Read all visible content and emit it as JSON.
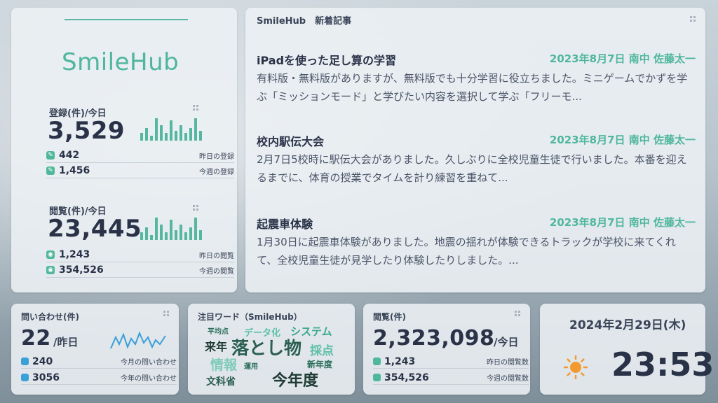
{
  "logo": "SmileHub",
  "registrations": {
    "title": "登録(件)/今日",
    "value": "3,529",
    "bars": [
      0.3,
      0.5,
      0.2,
      0.9,
      0.6,
      0.3,
      0.8,
      0.4,
      0.6,
      0.3,
      0.5,
      0.9,
      0.4
    ],
    "yesterday_value": "442",
    "yesterday_label": "昨日の登録",
    "week_value": "1,456",
    "week_label": "今週の登録"
  },
  "views": {
    "title": "閲覧(件)/今日",
    "value": "23,445",
    "bars": [
      0.3,
      0.5,
      0.2,
      0.9,
      0.6,
      0.3,
      0.8,
      0.4,
      0.6,
      0.3,
      0.5,
      0.9,
      0.4
    ],
    "yesterday_value": "1,243",
    "yesterday_label": "昨日の閲覧",
    "week_value": "354,526",
    "week_label": "今週の閲覧"
  },
  "news": {
    "header": "SmileHub　新着記事",
    "articles": [
      {
        "title": "iPadを使った足し算の学習",
        "meta": "2023年8月7日 南中 佐藤太一",
        "body": "有料版・無料版がありますが、無料版でも十分学習に役立ちました。ミニゲームでかずを学ぶ「ミッションモード」と学びたい内容を選択して学ぶ「フリーモ..."
      },
      {
        "title": "校内駅伝大会",
        "meta": "2023年8月7日 南中 佐藤太一",
        "body": "2月7日5校時に駅伝大会がありました。久しぶりに全校児童生徒で行いました。本番を迎えるまでに、体育の授業でタイムを計り練習を重ねて..."
      },
      {
        "title": "起震車体験",
        "meta": "2023年8月7日 南中 佐藤太一",
        "body": "1月30日に起震車体験がありました。地震の揺れが体験できるトラックが学校に来てくれて、全校児童生徒が見学したり体験したりしました。..."
      }
    ]
  },
  "inquiries": {
    "title": "問い合わせ(件)",
    "value": "22",
    "unit": "/昨日",
    "month_value": "240",
    "month_label": "今月の問い合わせ",
    "year_value": "3056",
    "year_label": "今年の問い合わせ"
  },
  "wordcloud": {
    "title": "注目ワード（SmileHub）",
    "words": [
      "平均点",
      "データ化",
      "システム",
      "来年",
      "落とし物",
      "採点",
      "情報",
      "運用",
      "新年度",
      "文科省",
      "今年度"
    ]
  },
  "pageviews": {
    "title": "閲覧(件)",
    "value": "2,323,098",
    "unit": "/今日",
    "yesterday_value": "1,243",
    "yesterday_label": "昨日の閲覧数",
    "week_value": "354,526",
    "week_label": "今週の閲覧数"
  },
  "clock": {
    "date": "2024年2月29日(木)",
    "time": "23:53",
    "weather_icon": "sun-icon"
  },
  "colors": {
    "accent": "#4fb79c",
    "blue": "#3aa0d8",
    "sun": "#f29a2e"
  }
}
